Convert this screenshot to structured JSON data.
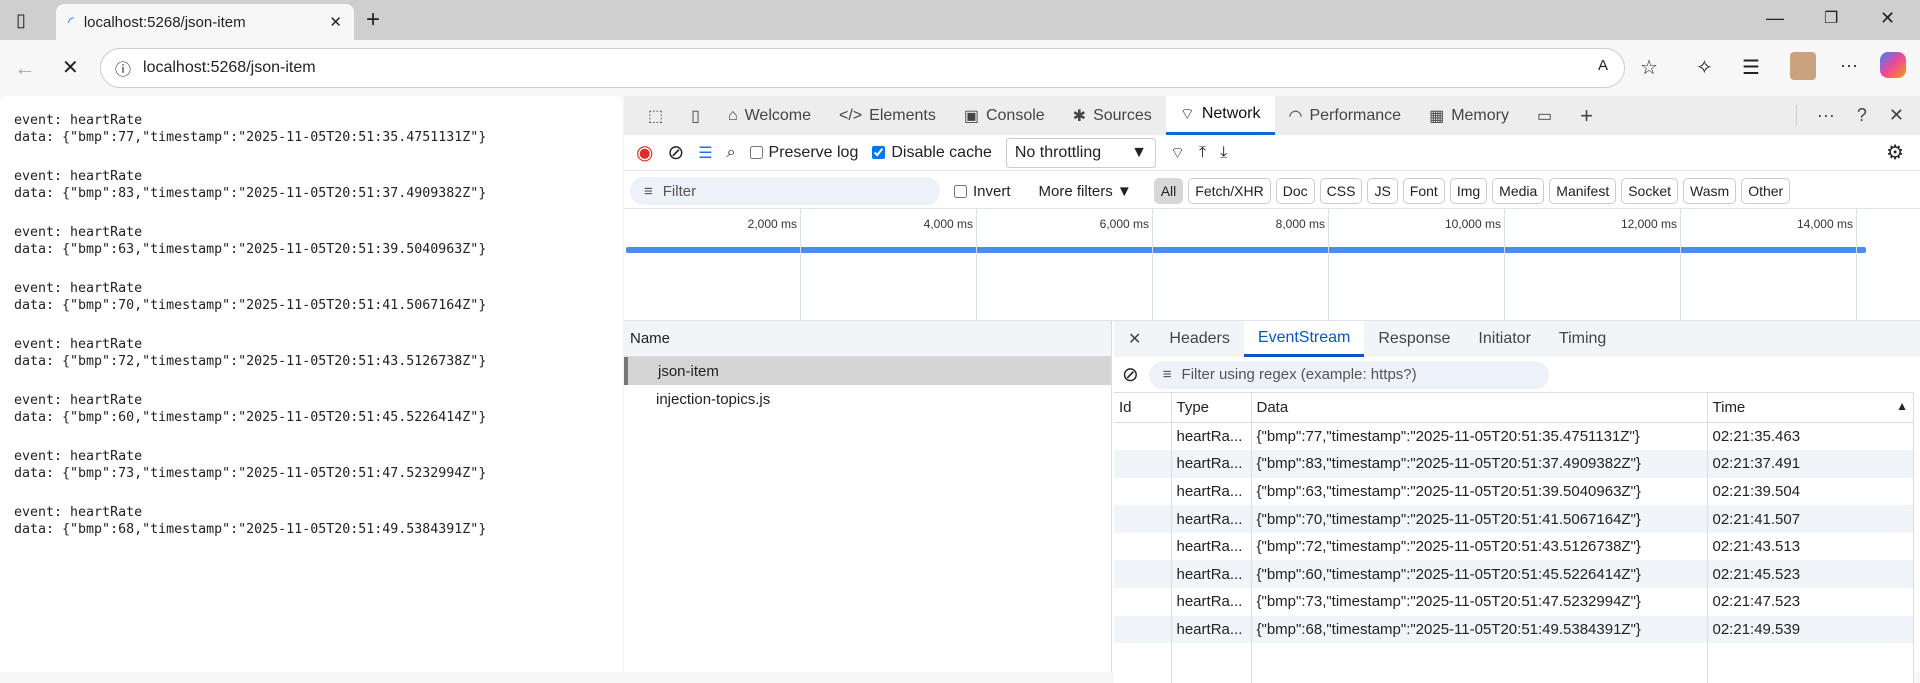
{
  "browser": {
    "tab_title": "localhost:5268/json-item",
    "url": "localhost:5268/json-item"
  },
  "page": {
    "events": [
      {
        "event": "event: heartRate",
        "data": "data: {\"bmp\":77,\"timestamp\":\"2025-11-05T20:51:35.4751131Z\"}"
      },
      {
        "event": "event: heartRate",
        "data": "data: {\"bmp\":83,\"timestamp\":\"2025-11-05T20:51:37.4909382Z\"}"
      },
      {
        "event": "event: heartRate",
        "data": "data: {\"bmp\":63,\"timestamp\":\"2025-11-05T20:51:39.5040963Z\"}"
      },
      {
        "event": "event: heartRate",
        "data": "data: {\"bmp\":70,\"timestamp\":\"2025-11-05T20:51:41.5067164Z\"}"
      },
      {
        "event": "event: heartRate",
        "data": "data: {\"bmp\":72,\"timestamp\":\"2025-11-05T20:51:43.5126738Z\"}"
      },
      {
        "event": "event: heartRate",
        "data": "data: {\"bmp\":60,\"timestamp\":\"2025-11-05T20:51:45.5226414Z\"}"
      },
      {
        "event": "event: heartRate",
        "data": "data: {\"bmp\":73,\"timestamp\":\"2025-11-05T20:51:47.5232994Z\"}"
      },
      {
        "event": "event: heartRate",
        "data": "data: {\"bmp\":68,\"timestamp\":\"2025-11-05T20:51:49.5384391Z\"}"
      }
    ]
  },
  "devtools": {
    "tabs": [
      "Welcome",
      "Elements",
      "Console",
      "Sources",
      "Network",
      "Performance",
      "Memory"
    ],
    "toolbar": {
      "preserve_log": "Preserve log",
      "disable_cache": "Disable cache",
      "throttling": "No throttling"
    },
    "filter": {
      "placeholder": "Filter",
      "invert": "Invert",
      "more_filters": "More filters",
      "types": [
        "All",
        "Fetch/XHR",
        "Doc",
        "CSS",
        "JS",
        "Font",
        "Img",
        "Media",
        "Manifest",
        "Socket",
        "Wasm",
        "Other"
      ]
    },
    "timeline": {
      "ticks": [
        "2,000 ms",
        "4,000 ms",
        "6,000 ms",
        "8,000 ms",
        "10,000 ms",
        "12,000 ms",
        "14,000 ms"
      ]
    },
    "requests": {
      "header": "Name",
      "items": [
        "json-item",
        "injection-topics.js"
      ]
    },
    "detail": {
      "tabs": [
        "Headers",
        "EventStream",
        "Response",
        "Initiator",
        "Timing"
      ],
      "filter_placeholder": "Filter using regex (example: https?)",
      "columns": [
        "Id",
        "Type",
        "Data",
        "Time"
      ],
      "rows": [
        {
          "type": "heartRa...",
          "data": "{\"bmp\":77,\"timestamp\":\"2025-11-05T20:51:35.4751131Z\"}",
          "time": "02:21:35.463"
        },
        {
          "type": "heartRa...",
          "data": "{\"bmp\":83,\"timestamp\":\"2025-11-05T20:51:37.4909382Z\"}",
          "time": "02:21:37.491"
        },
        {
          "type": "heartRa...",
          "data": "{\"bmp\":63,\"timestamp\":\"2025-11-05T20:51:39.5040963Z\"}",
          "time": "02:21:39.504"
        },
        {
          "type": "heartRa...",
          "data": "{\"bmp\":70,\"timestamp\":\"2025-11-05T20:51:41.5067164Z\"}",
          "time": "02:21:41.507"
        },
        {
          "type": "heartRa...",
          "data": "{\"bmp\":72,\"timestamp\":\"2025-11-05T20:51:43.5126738Z\"}",
          "time": "02:21:43.513"
        },
        {
          "type": "heartRa...",
          "data": "{\"bmp\":60,\"timestamp\":\"2025-11-05T20:51:45.5226414Z\"}",
          "time": "02:21:45.523"
        },
        {
          "type": "heartRa...",
          "data": "{\"bmp\":73,\"timestamp\":\"2025-11-05T20:51:47.5232994Z\"}",
          "time": "02:21:47.523"
        },
        {
          "type": "heartRa...",
          "data": "{\"bmp\":68,\"timestamp\":\"2025-11-05T20:51:49.5384391Z\"}",
          "time": "02:21:49.539"
        }
      ]
    }
  }
}
